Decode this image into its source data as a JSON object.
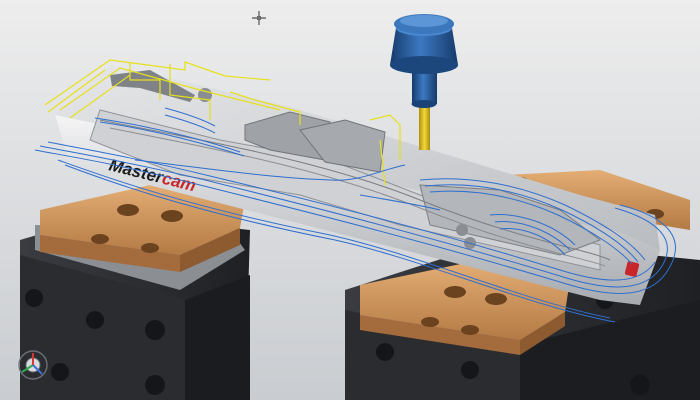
{
  "view": {
    "background_top": "#ededed",
    "background_bottom": "#c9ccd0"
  },
  "part": {
    "brand_text_1": "Master",
    "brand_text_2": "cam",
    "brand_color_1": "#1d1d1d",
    "brand_color_2": "#c8262a",
    "material_color": "#c8cacd"
  },
  "toolpath": {
    "cut_color": "#2f6fd0",
    "rapid_color": "#e6e01a"
  },
  "tool": {
    "holder_color": "#1f4f8f",
    "flute_color": "#e3c21a"
  },
  "fixture": {
    "vise_color": "#2b2d31",
    "jaw_color": "#c9925a"
  },
  "icons": {
    "cursor": "crosshair-icon",
    "triad": "view-axis-triad-icon"
  }
}
